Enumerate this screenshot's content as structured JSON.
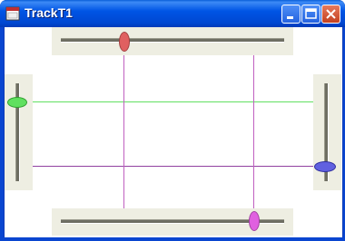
{
  "window": {
    "title": "TrackT1",
    "app_icon": "application-icon",
    "buttons": {
      "minimize": "minimize-icon",
      "maximize": "maximize-icon",
      "close": "close-icon"
    }
  },
  "sliders": {
    "top": {
      "orientation": "horizontal",
      "thumb_color": "#e06060",
      "line_color": "#c060c0",
      "level": 0.29
    },
    "bottom": {
      "orientation": "horizontal",
      "thumb_color": "#e060e0",
      "line_color": "#c060c0",
      "level": 0.83
    },
    "left": {
      "orientation": "vertical",
      "thumb_color": "#60e060",
      "line_color": "#60e060",
      "level": 0.36
    },
    "right": {
      "orientation": "vertical",
      "thumb_color": "#6060e0",
      "line_color": "#9040a0",
      "level": 0.97
    }
  },
  "colors": {
    "track_bg": "#eeeee2",
    "titlebar": "#0055e5"
  }
}
